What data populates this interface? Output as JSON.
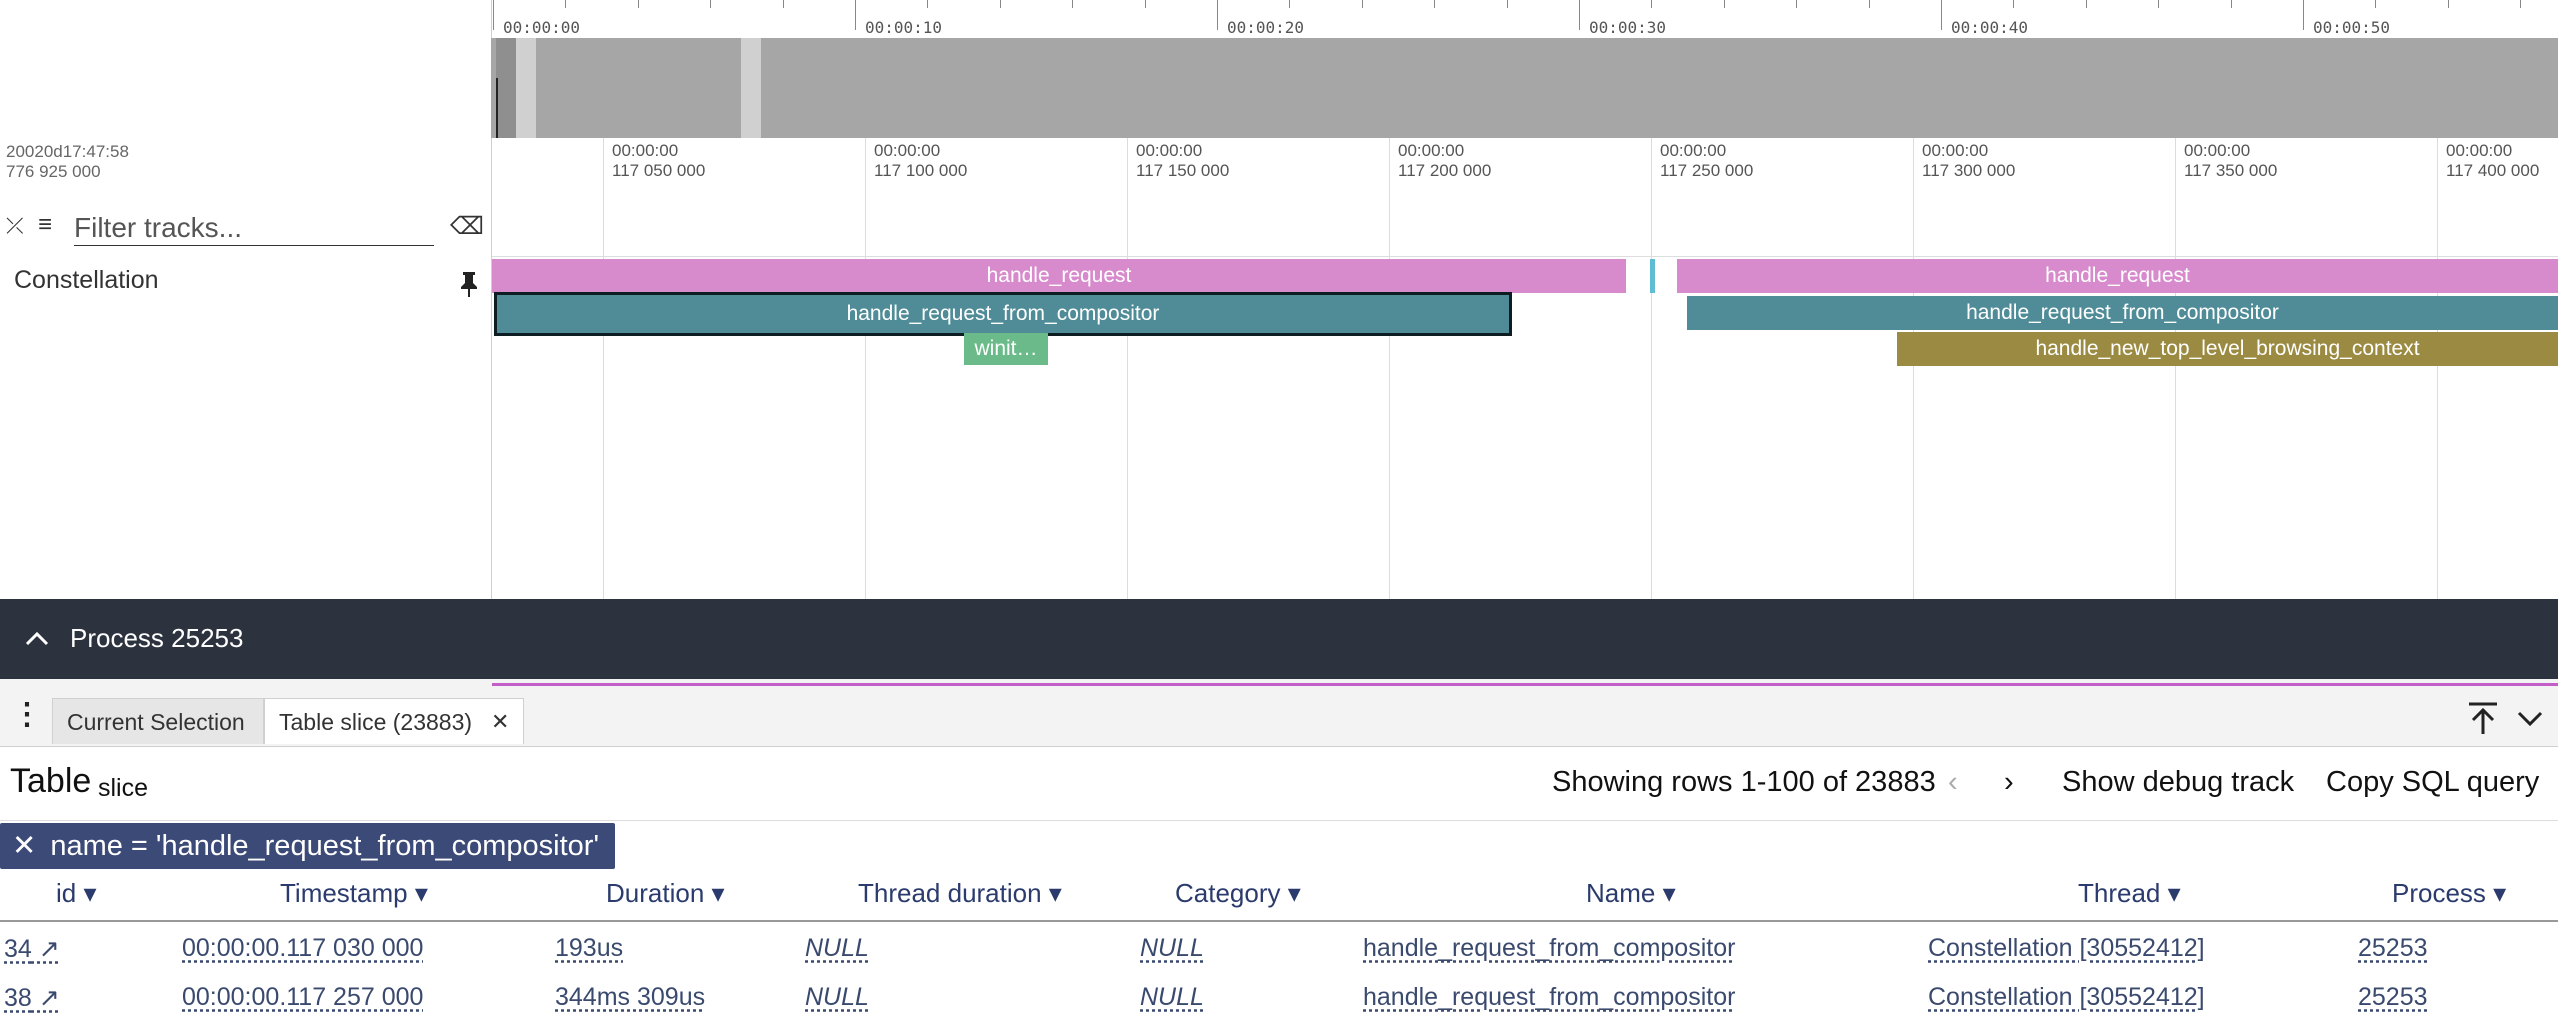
{
  "overview": {
    "ticks": [
      "00:00:00",
      "00:00:10",
      "00:00:20",
      "00:00:30",
      "00:00:40",
      "00:00:50"
    ]
  },
  "timeaxis": {
    "start_line1": "20020d17:47:58",
    "start_line2": "776 925 000",
    "labels": [
      {
        "top": "00:00:00",
        "bottom": "117 050 000"
      },
      {
        "top": "00:00:00",
        "bottom": "117 100 000"
      },
      {
        "top": "00:00:00",
        "bottom": "117 150 000"
      },
      {
        "top": "00:00:00",
        "bottom": "117 200 000"
      },
      {
        "top": "00:00:00",
        "bottom": "117 250 000"
      },
      {
        "top": "00:00:00",
        "bottom": "117 300 000"
      },
      {
        "top": "00:00:00",
        "bottom": "117 350 000"
      },
      {
        "top": "00:00:00",
        "bottom": "117 400 000"
      }
    ]
  },
  "filter": {
    "placeholder": "Filter tracks..."
  },
  "track": {
    "name": "Constellation",
    "slices": {
      "s1": "handle_request",
      "s2": "handle_request",
      "s3": "handle_request_from_compositor",
      "s4": "handle_request_from_compositor",
      "s5": "winit…",
      "s6": "handle_new_top_level_browsing_context"
    },
    "colors": {
      "pink": "#d88bcc",
      "teal": "#4f8c97",
      "green": "#6bbb8a",
      "olive": "#9b8b42",
      "cyan": "#5fbcd3"
    }
  },
  "process": {
    "label": "Process 25253"
  },
  "tabs": {
    "current_selection": "Current Selection",
    "table_slice": "Table slice (23883)"
  },
  "table": {
    "title": "Table",
    "subtitle": "slice",
    "rows_info": "Showing rows 1-100 of 23883",
    "show_debug": "Show debug track",
    "copy_sql": "Copy SQL query",
    "filter_chip": "name = 'handle_request_from_compositor'",
    "columns": [
      "id",
      "Timestamp",
      "Duration",
      "Thread duration",
      "Category",
      "Name",
      "Thread",
      "Process"
    ],
    "rows": [
      [
        "34",
        "00:00:00.117 030 000",
        "193us",
        "NULL",
        "NULL",
        "handle_request_from_compositor",
        "Constellation [30552412]",
        "25253"
      ],
      [
        "38",
        "00:00:00.117 257 000",
        "344ms 309us",
        "NULL",
        "NULL",
        "handle_request_from_compositor",
        "Constellation [30552412]",
        "25253"
      ]
    ]
  }
}
